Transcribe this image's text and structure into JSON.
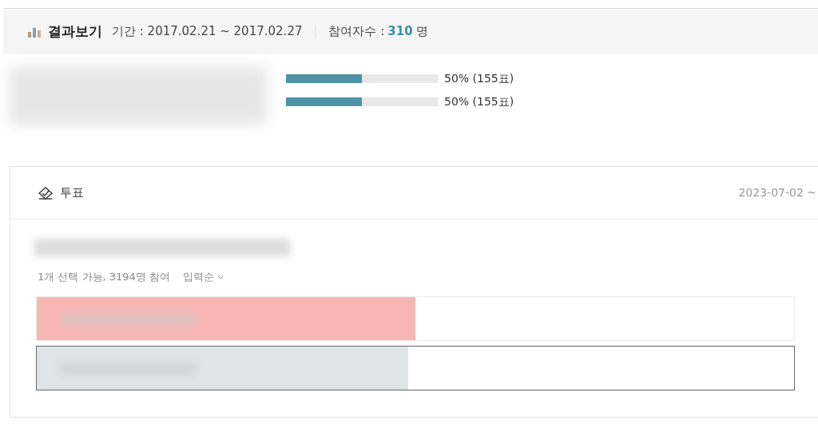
{
  "result_header": {
    "title": "결과보기",
    "period_label": "기간 : 2017.02.21 ~ 2017.02.27",
    "participants_label": "참여자수 : ",
    "participants_count": "310",
    "participants_unit": "명"
  },
  "results": [
    {
      "level": 0.5,
      "reading": "50% (155표)"
    },
    {
      "level": 0.5,
      "reading": "50% (155표)"
    }
  ],
  "poll_card": {
    "title": "투표",
    "date": "2023-07-02 ~",
    "meta": "1개 선택 가능, 3194명 참여",
    "sort": "입력순",
    "options": [
      {
        "level": 0.5,
        "color": "#f7b6b3",
        "selected": false
      },
      {
        "level": 0.49,
        "color": "#dfe4e6",
        "selected": true
      }
    ]
  }
}
